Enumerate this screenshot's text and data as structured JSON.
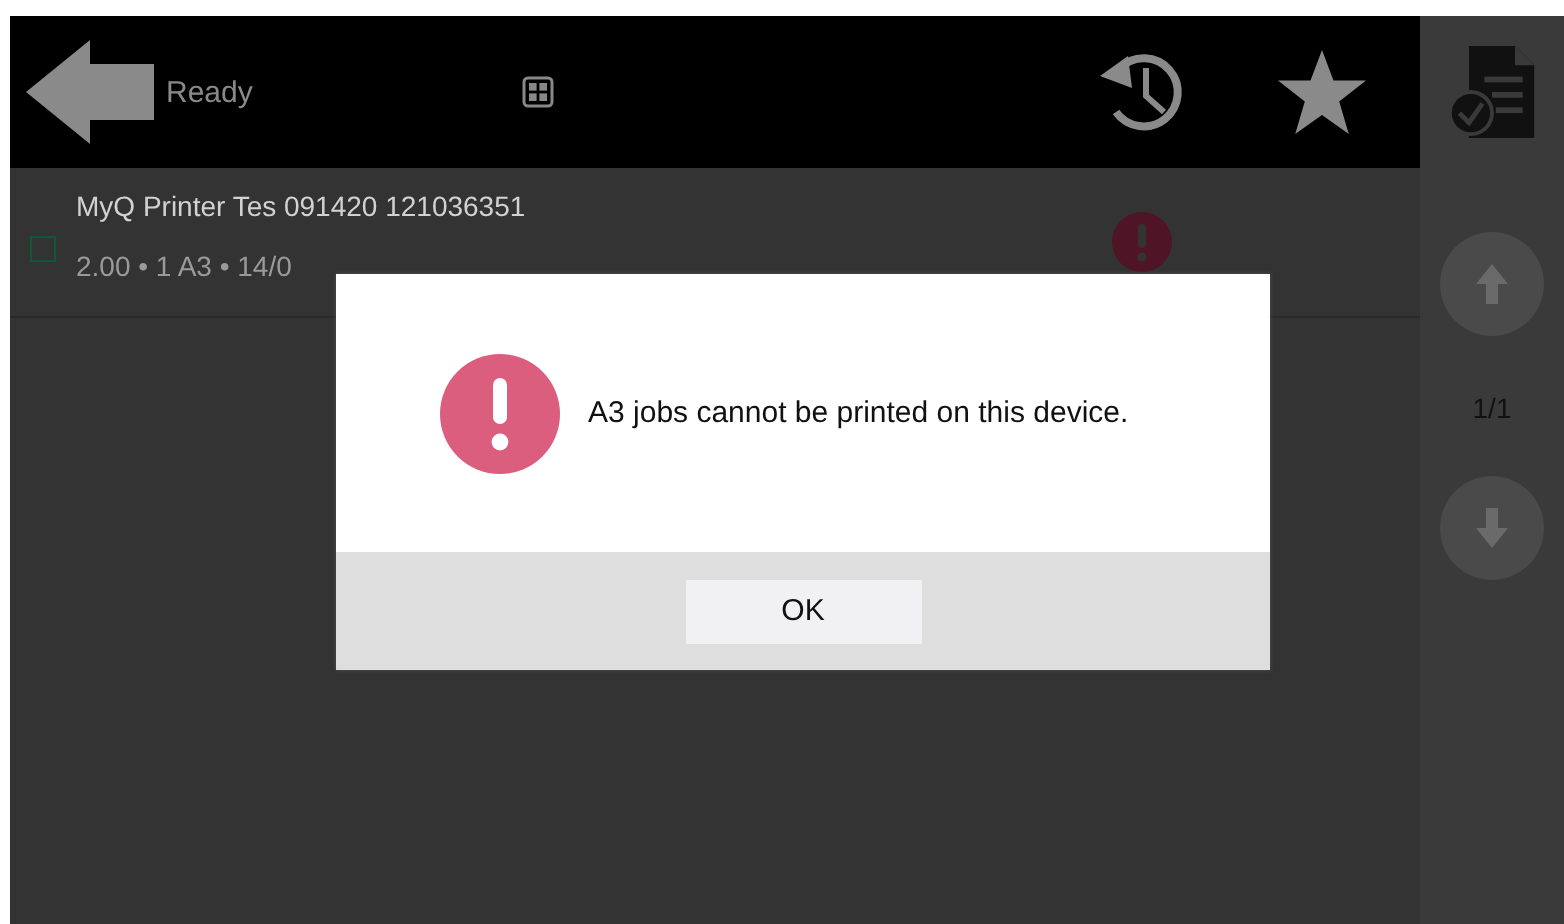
{
  "header": {
    "status": "Ready"
  },
  "jobs": [
    {
      "name": "MyQ Printer Tes 091420 121036351",
      "details": "2.00 • 1 A3 • 14/0",
      "selected": false,
      "error": true
    }
  ],
  "pager": {
    "page": "1/1"
  },
  "dialog": {
    "message": "A3 jobs cannot be printed on this device.",
    "buttons": [
      "OK"
    ]
  }
}
